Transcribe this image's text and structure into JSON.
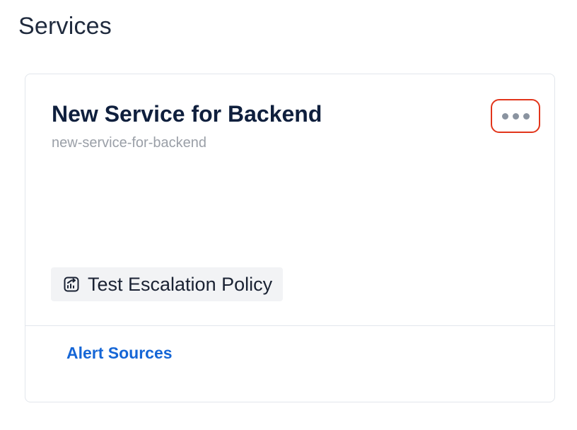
{
  "page": {
    "title": "Services"
  },
  "service_card": {
    "name": "New Service for Backend",
    "slug": "new-service-for-backend",
    "more_button_icon": "more-horizontal-icon",
    "escalation_policy": {
      "icon": "escalation-policy-icon",
      "label": "Test Escalation Policy"
    },
    "footer_link": "Alert Sources"
  },
  "colors": {
    "highlight_border": "#e2351b",
    "link": "#1566d6",
    "title": "#0f1f3d",
    "muted": "#9a9fa7"
  }
}
